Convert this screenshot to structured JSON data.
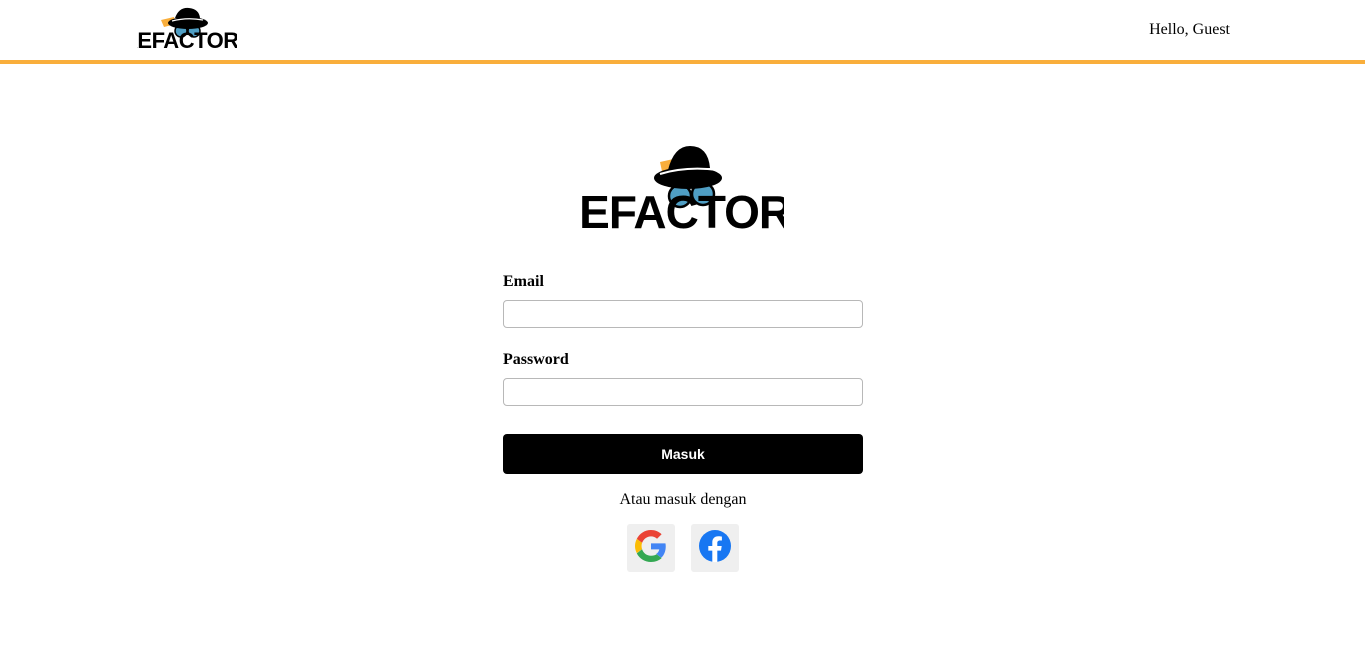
{
  "header": {
    "logo_text": "REFACTORY",
    "greeting": "Hello, Guest"
  },
  "main": {
    "logo_text": "REFACTORY"
  },
  "form": {
    "email_label": "Email",
    "email_value": "",
    "password_label": "Password",
    "password_value": "",
    "submit_label": "Masuk",
    "alt_login_text": "Atau masuk dengan"
  },
  "social": [
    {
      "icon": "google-icon"
    },
    {
      "icon": "facebook-icon"
    }
  ],
  "colors": {
    "accent": "#f9ae3b",
    "button_bg": "#000000",
    "social_bg": "#efefef",
    "facebook_blue": "#1877f2",
    "logo_lens": "#4f9ec4"
  }
}
